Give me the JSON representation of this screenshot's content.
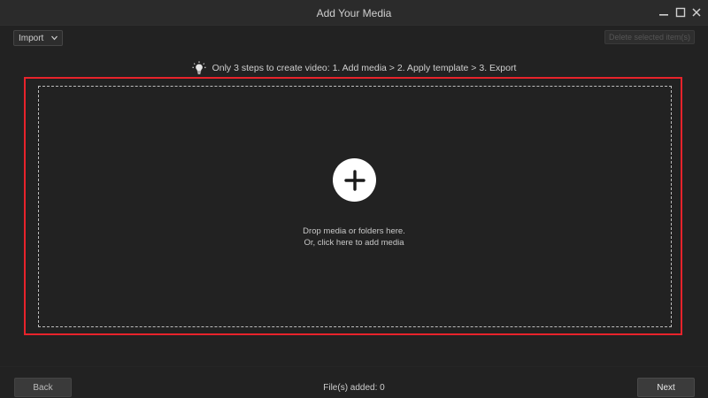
{
  "window": {
    "title": "Add Your Media",
    "controls": [
      "minimize-icon",
      "maximize-icon",
      "close-icon"
    ]
  },
  "toolbar": {
    "import_label": "Import",
    "delete_label": "Delete selected item(s)"
  },
  "tip": {
    "icon": "lightbulb-icon",
    "text": "Only 3 steps to create video: 1. Add media > 2. Apply template > 3. Export"
  },
  "dropzone": {
    "icon": "plus-icon",
    "line1": "Drop media or folders here.",
    "line2": "Or, click here to add media",
    "highlight_color": "#e8232b"
  },
  "footer": {
    "back_label": "Back",
    "files_added": "File(s) added: 0",
    "next_label": "Next"
  }
}
